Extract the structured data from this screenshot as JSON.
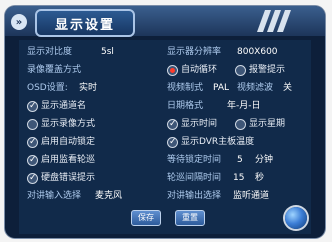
{
  "title": "显示设置",
  "rows": [
    {
      "a_label": "显示对比度",
      "a_value": "5sl",
      "b_label": "显示器分辨率",
      "b_value": "800X600"
    },
    {
      "a_label": "录像覆盖方式",
      "b_opt1": "自动循环",
      "b_opt2": "报警提示"
    },
    {
      "a_label": "OSD设置:",
      "a_value": "实时",
      "b_label": "视频制式",
      "b_value": "PAL",
      "c_label": "视频滤波",
      "c_value": "关"
    },
    {
      "a_opt": "显示通道名",
      "b_label": "日期格式",
      "b_value": "年-月-日"
    },
    {
      "a_opt": "显示录像方式",
      "b_opt1": "显示时间",
      "b_opt2": "显示星期"
    },
    {
      "a_opt": "启用自动锁定",
      "b_opt": "显示DVR主板温度"
    },
    {
      "a_opt": "启用监看轮巡",
      "b_label": "等待锁定时间",
      "b_value": "5",
      "b_unit": "分钟"
    },
    {
      "a_opt": "硬盘错误提示",
      "b_label": "轮巡间隔时间",
      "b_value": "15",
      "b_unit": "秒"
    },
    {
      "a_label": "对讲输入选择",
      "a_value": "麦克风",
      "b_label": "对讲输出选择",
      "b_value": "监听通道"
    }
  ],
  "buttons": {
    "save": "保存",
    "reset": "重置"
  },
  "back_icon_glyph": "»"
}
